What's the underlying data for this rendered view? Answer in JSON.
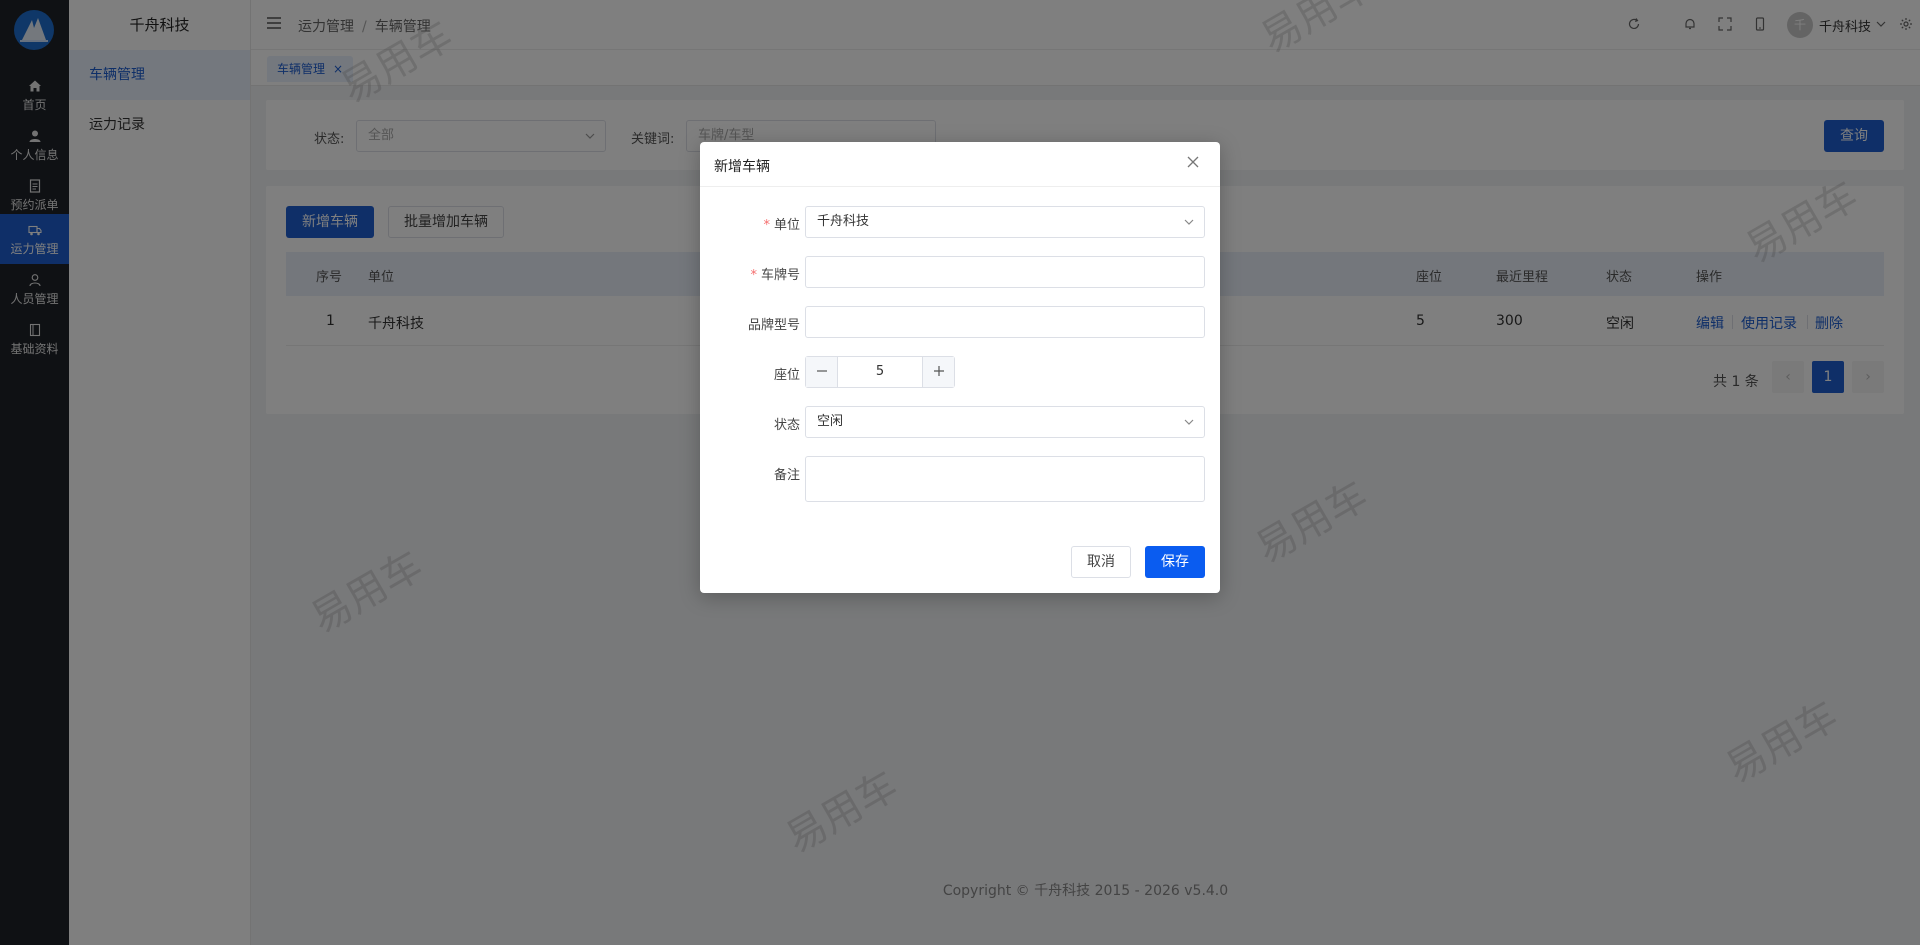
{
  "rail": {
    "items": [
      {
        "label": "首页",
        "icon": "home-icon"
      },
      {
        "label": "个人信息",
        "icon": "user-icon"
      },
      {
        "label": "预约派单",
        "icon": "document-icon"
      },
      {
        "label": "运力管理",
        "icon": "truck-icon",
        "active": true
      },
      {
        "label": "人员管理",
        "icon": "person-icon"
      },
      {
        "label": "基础资料",
        "icon": "book-icon"
      }
    ]
  },
  "sidebar": {
    "title": "千舟科技",
    "items": [
      {
        "label": "车辆管理",
        "active": true
      },
      {
        "label": "运力记录"
      }
    ]
  },
  "header": {
    "breadcrumbs": [
      "运力管理",
      "车辆管理"
    ],
    "breadcrumb_sep": "/",
    "avatar_letter": "千",
    "user_name": "千舟科技"
  },
  "tabs": [
    {
      "label": "车辆管理",
      "close": "×"
    }
  ],
  "filter": {
    "status_label": "状态:",
    "status_value": "全部",
    "keyword_label": "关键词:",
    "keyword_placeholder": "车牌/车型",
    "query_button": "查询"
  },
  "toolbar": {
    "add_button": "新增车辆",
    "batch_add_button": "批量增加车辆"
  },
  "table": {
    "columns": [
      "序号",
      "单位",
      "座位",
      "最近里程",
      "状态",
      "操作"
    ],
    "rows": [
      {
        "index": "1",
        "unit": "千舟科技",
        "seats": "5",
        "mileage": "300",
        "status": "空闲",
        "actions": [
          "编辑",
          "使用记录",
          "删除"
        ]
      }
    ]
  },
  "pagination": {
    "total": "共 1 条",
    "prev": "‹",
    "current": "1",
    "next": "›"
  },
  "footer": "Copyright © 千舟科技 2015 - 2026 v5.4.0",
  "watermark": "易用车",
  "dialog": {
    "title": "新增车辆",
    "fields": {
      "unit_label": "单位",
      "unit_value": "千舟科技",
      "plate_label": "车牌号",
      "plate_value": "",
      "model_label": "品牌型号",
      "model_value": "",
      "seats_label": "座位",
      "seats_value": "5",
      "status_label": "状态",
      "status_value": "空闲",
      "remark_label": "备注",
      "remark_value": ""
    },
    "required_mark": "*",
    "cancel_button": "取消",
    "save_button": "保存"
  },
  "colors": {
    "primary": "#1e5fd1",
    "rail_bg": "#1f2329",
    "required": "#f56c6c"
  }
}
